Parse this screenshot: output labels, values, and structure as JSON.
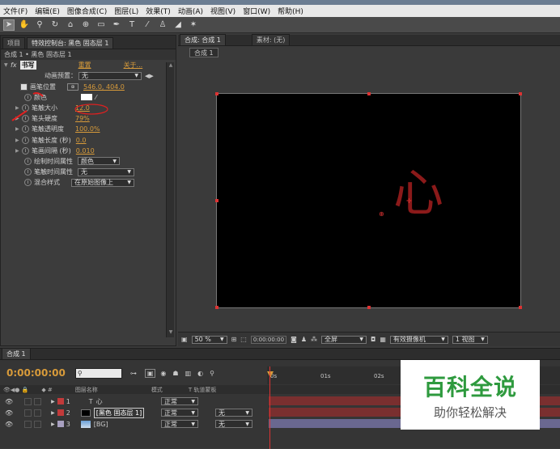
{
  "menu": [
    "文件(F)",
    "编辑(E)",
    "图像合成(C)",
    "图层(L)",
    "效果(T)",
    "动画(A)",
    "视图(V)",
    "窗口(W)",
    "帮助(H)"
  ],
  "tools": [
    "selection-tool",
    "hand-tool",
    "zoom-tool",
    "rotate-tool",
    "camera-tool",
    "pan-behind-tool",
    "rectangle-tool",
    "pen-tool",
    "text-tool",
    "brush-tool",
    "clone-stamp-tool",
    "eraser-tool",
    "puppet-tool"
  ],
  "left_panel": {
    "tabs": [
      "项目",
      "特效控制台: 黑色 固态层 1"
    ],
    "breadcrumb": "合成 1 • 黑色 固态层 1",
    "fx_label": "fx",
    "effect_name": "书写",
    "reset": "重置",
    "about": "关于...",
    "anim_preset_label": "动画预置：",
    "anim_preset_value": "无",
    "properties": [
      {
        "label": "画笔位置",
        "value": "546.0, 404.0"
      },
      {
        "label": "颜色",
        "value": ""
      },
      {
        "label": "笔触大小",
        "value": "12.0"
      },
      {
        "label": "笔头硬度",
        "value": "79%"
      },
      {
        "label": "笔触透明度",
        "value": "100.0%"
      },
      {
        "label": "笔触长度 (秒)",
        "value": "0.0"
      },
      {
        "label": "笔画间隔 (秒)",
        "value": "0.010"
      },
      {
        "label": "绘制时间属性",
        "value": "颜色"
      },
      {
        "label": "笔触时间属性",
        "value": "无"
      },
      {
        "label": "混合样式",
        "value": "在原始图像上"
      }
    ]
  },
  "comp_panel": {
    "tabs": [
      "合成: 合成 1",
      "素材: (无)"
    ],
    "sub_tab": "合成 1",
    "glyph": "心",
    "footer": {
      "zoom": "50 %",
      "timecode": "0:00:00:00",
      "resolution": "全屏",
      "camera": "有效摄像机",
      "views": "1 视图"
    }
  },
  "timeline": {
    "tab": "合成 1",
    "timecode": "0:00:00:00",
    "columns": {
      "name": "图层名称",
      "mode": "模式",
      "trkmat": "T  轨道蒙板"
    },
    "ruler": [
      "0s",
      "01s",
      "02s"
    ],
    "layers": [
      {
        "num": "1",
        "name": "心",
        "mode": "正常",
        "trkmat": "",
        "color": "#c23a3a"
      },
      {
        "num": "2",
        "name": "[黑色 固态层 1]",
        "mode": "正常",
        "trkmat": "无",
        "color": "#c23a3a"
      },
      {
        "num": "3",
        "name": "[BG]",
        "mode": "正常",
        "trkmat": "无",
        "color": "#a8a0c0"
      }
    ]
  },
  "watermark": {
    "title": "百科全说",
    "subtitle": "助你轻松解决"
  },
  "colors": {
    "accent_orange": "#d89b3a",
    "stroke_red": "#8b1a1a",
    "wm_green": "#2e9a3e"
  }
}
